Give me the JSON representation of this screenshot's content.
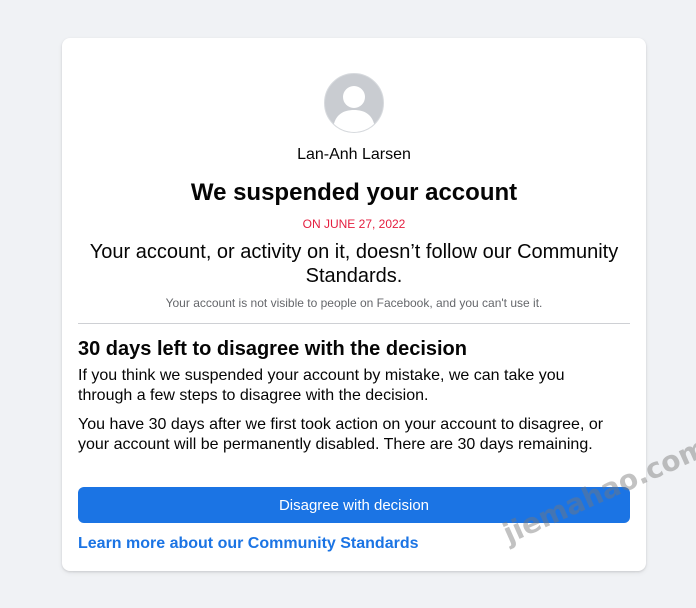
{
  "account": {
    "user_name": "Lan-Anh Larsen",
    "avatar_icon": "default-user-avatar-icon"
  },
  "notice": {
    "headline": "We suspended your account",
    "date": "ON JUNE 27, 2022",
    "reason": "Your account, or activity on it, doesn’t follow our Community Standards.",
    "visibility_note": "Your account is not visible to people on Facebook, and you can't use it."
  },
  "appeal": {
    "title": "30 days left to disagree with the decision",
    "paragraph_1": "If you think we suspended your account by mistake, we can take you through a few steps to disagree with the decision.",
    "paragraph_2": "You have 30 days after we first took action on your account to disagree, or your account will be permanently disabled. There are 30 days remaining.",
    "button_label": "Disagree with decision",
    "link_label": "Learn more about our Community Standards"
  },
  "watermark": "jiemahao.com",
  "colors": {
    "accent": "#1b74e4",
    "date_red": "#e41e3f",
    "background": "#f0f2f5"
  }
}
